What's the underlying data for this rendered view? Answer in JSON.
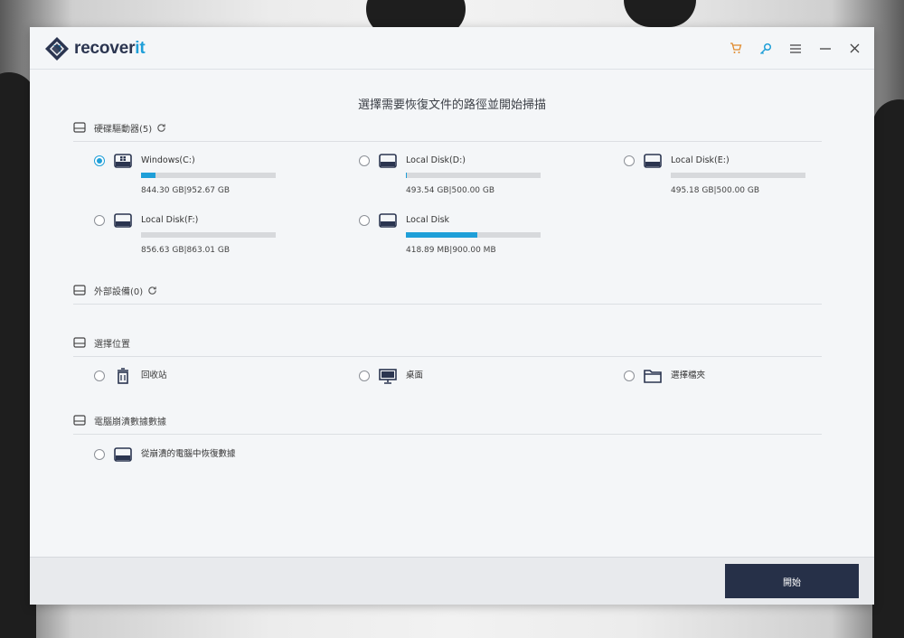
{
  "app": {
    "logo_text_main": "recover",
    "logo_text_accent": "it"
  },
  "titlebar": {
    "icons": [
      "cart-icon",
      "key-icon",
      "menu-icon",
      "minimize-icon",
      "close-icon"
    ]
  },
  "headline": "選擇需要恢復文件的路徑並開始掃描",
  "sections": {
    "hard_drives": {
      "title": "硬碟驅動器(5)",
      "drives": [
        {
          "label": "Windows(C:)",
          "size": "844.30  GB|952.67  GB",
          "used_fraction": 0.11,
          "selected": true
        },
        {
          "label": "Local Disk(D:)",
          "size": "493.54  GB|500.00  GB",
          "used_fraction": 0.01,
          "selected": false
        },
        {
          "label": "Local Disk(E:)",
          "size": "495.18  GB|500.00  GB",
          "used_fraction": 0.0,
          "selected": false
        },
        {
          "label": "Local Disk(F:)",
          "size": "856.63  GB|863.01  GB",
          "used_fraction": 0.0,
          "selected": false
        },
        {
          "label": "Local Disk",
          "size": "418.89  MB|900.00  MB",
          "used_fraction": 0.53,
          "selected": false
        }
      ]
    },
    "external": {
      "title": "外部設備(0)"
    },
    "location": {
      "title": "選擇位置",
      "items": [
        {
          "label": "回收站",
          "icon": "recycle-bin-icon"
        },
        {
          "label": "桌面",
          "icon": "desktop-icon"
        },
        {
          "label": "選擇檔夾",
          "icon": "folder-icon"
        }
      ]
    },
    "crash": {
      "title": "電腦崩潰數據數據",
      "item_label": "從崩潰的電腦中恢復數據"
    }
  },
  "footer": {
    "start_label": "開始"
  },
  "colors": {
    "accent": "#1f9fd8",
    "dark_button": "#263048",
    "window_bg": "#f4f6f8"
  }
}
